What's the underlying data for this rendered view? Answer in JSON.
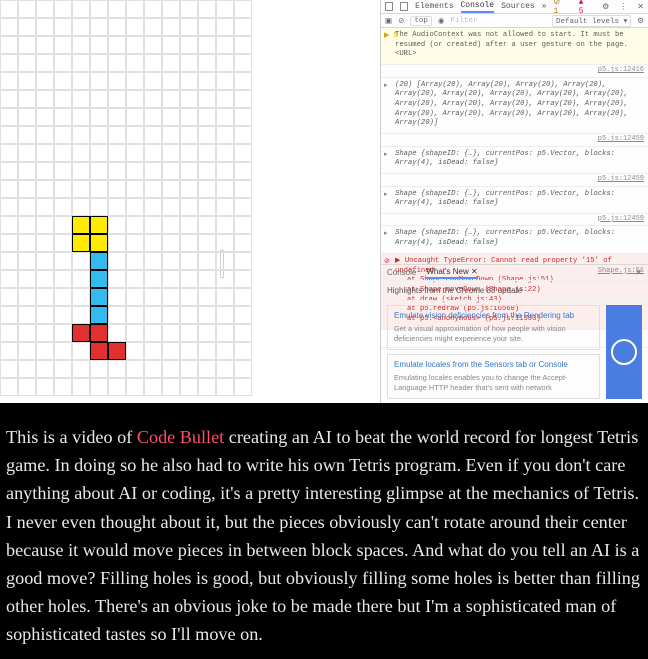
{
  "devtools": {
    "tabs": {
      "elements": "Elements",
      "console": "Console",
      "sources": "Sources",
      "more": "»"
    },
    "counts": {
      "errors": "1",
      "warnings": "5"
    },
    "filter_row": {
      "top": "top",
      "eye_icon": "eye-icon",
      "filter": "Filter",
      "levels": "Default levels ▾"
    },
    "messages": {
      "m1": {
        "text": "The AudioContext was not allowed to start. It must be resumed (or created) after a user gesture on the page. <URL>",
        "src": "p5.js:12416"
      },
      "m2": {
        "text": "(20) [Array(20), Array(20), Array(20), Array(20), Array(20), Array(20), Array(20), Array(20), Array(20), Array(20), Array(20), Array(20), Array(20), Array(20), Array(20), Array(20), Array(20), Array(20), Array(20), Array(20)]",
        "src": "p5.js:12459"
      },
      "m3": {
        "text": "Shape {shapeID: {…}, currentPos: p5.Vector, blocks: Array(4), isDead: false}",
        "src": "p5.js:12459"
      },
      "m4": {
        "text": "Shape {shapeID: {…}, currentPos: p5.Vector, blocks: Array(4), isDead: false}",
        "src": "p5.js:12459"
      },
      "m5": {
        "text": "Shape {shapeID: {…}, currentPos: p5.Vector, blocks: Array(4), isDead: false}",
        "src": "p5.js:12459"
      },
      "err": {
        "lead": "▶ Uncaught TypeError: Cannot read property '15' of undefined",
        "t1": "at Shape.canMoveDown (Shape.js:51)",
        "t2": "at Shape.moveDown (Shape.js:22)",
        "t3": "at draw (sketch.js:43)",
        "t4": "at p5.redraw (p5.js:16560)",
        "t5": "at p5.<anonymous> (p5.js:11593)",
        "src": "Shape.js:51"
      }
    },
    "bottom": {
      "console_tab": "Console",
      "whatsnew_tab": "What's New ✕",
      "highlights": "Highlights from the Chrome 83 update",
      "card1_title": "Emulate vision deficiencies from the Rendering tab",
      "card1_body": "Get a visual approximation of how people with vision deficiencies might experience your site.",
      "card2_title": "Emulate locales from the Sensors tab or Console",
      "card2_body": "Emulating locales enables you to change the Accept-Language HTTP header that's sent with network"
    }
  },
  "article": {
    "pre": "This is a video of ",
    "link": "Code Bullet",
    "post": " creating an AI to beat the world record for longest Tetris game. In doing so he also had to write his own Tetris program. Even if you don't care anything about AI or coding, it's a pretty interesting glimpse at the mechanics of Tetris. I never even thought about it, but the pieces obviously can't rotate around their center because it would move pieces in between block spaces. And what do you tell an AI is a good move? Filling holes is good, but obviously filling some holes is better than filling other holes. There's an obvious joke to be made there but I'm a sophisticated man of sophisticated tastes so I'll move on."
  }
}
